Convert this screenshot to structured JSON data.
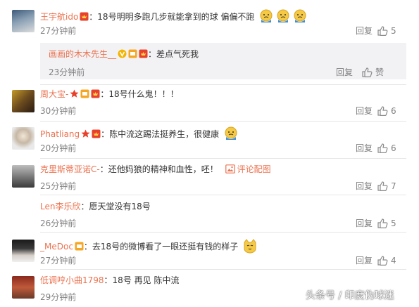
{
  "comments": [
    {
      "user": "王宇航ido",
      "text": "：18号明明多跑几步就能拿到的球 偏偏不跑",
      "time": "27分钟前",
      "reply": "回复",
      "likes": "5",
      "sub": {
        "user": "画画的木木先生__",
        "text": "：差点气死我",
        "time": "23分钟前",
        "reply": "回复",
        "like_label": "赞"
      }
    },
    {
      "user": "周大宝-",
      "text": "：18号什么鬼！！！",
      "time": "30分钟前",
      "reply": "回复",
      "likes": "6"
    },
    {
      "user": "Phatliang",
      "text": "：陈中流这踢法挺养生，很健康",
      "time": "20分钟前",
      "reply": "回复",
      "likes": "6"
    },
    {
      "user": "克里斯蒂亚诺C-",
      "text": "：还他妈狼的精神和血性，呸！",
      "image_link": "评论配图",
      "time": "25分钟前",
      "reply": "回复",
      "likes": "7"
    },
    {
      "user": "Len李乐欣",
      "text": "：愿天堂没有18号",
      "time": "26分钟前",
      "reply": "回复",
      "likes": "5"
    },
    {
      "user": "_MeDoc",
      "text": "：去18号的微博看了一眼还挺有钱的样子",
      "time": "27分钟前",
      "reply": "回复",
      "likes": "4"
    },
    {
      "user": "低调哼小曲1798",
      "text": "：18号 再见 陈中流",
      "time": "29分钟前",
      "reply": "回复",
      "likes": ""
    }
  ],
  "watermark": "头条号 / 印度伪球迷",
  "colors": {
    "username": "#eb7350",
    "meta": "#808080",
    "sub_bg": "#f2f2f5"
  }
}
